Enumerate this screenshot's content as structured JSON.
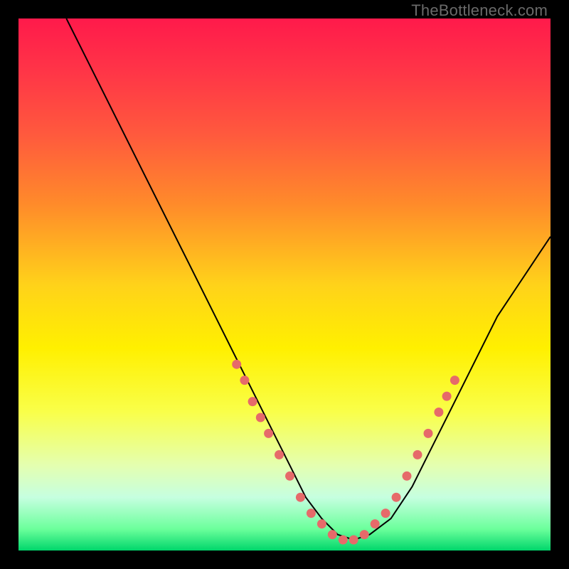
{
  "watermark": "TheBottleneck.com",
  "chart_data": {
    "type": "line",
    "title": "",
    "xlabel": "",
    "ylabel": "",
    "xlim": [
      0,
      100
    ],
    "ylim": [
      0,
      100
    ],
    "gradient_stops": [
      {
        "offset": 0.0,
        "color": "#ff1a4b"
      },
      {
        "offset": 0.1,
        "color": "#ff3547"
      },
      {
        "offset": 0.22,
        "color": "#ff5a3d"
      },
      {
        "offset": 0.35,
        "color": "#ff8b2a"
      },
      {
        "offset": 0.5,
        "color": "#ffd21a"
      },
      {
        "offset": 0.62,
        "color": "#fff000"
      },
      {
        "offset": 0.74,
        "color": "#f9ff4a"
      },
      {
        "offset": 0.84,
        "color": "#e4ffb0"
      },
      {
        "offset": 0.9,
        "color": "#c6ffe0"
      },
      {
        "offset": 0.96,
        "color": "#6bff9b"
      },
      {
        "offset": 1.0,
        "color": "#00d66b"
      }
    ],
    "series": [
      {
        "name": "bottleneck-curve",
        "type": "line",
        "x": [
          9,
          12,
          16,
          20,
          24,
          28,
          32,
          36,
          40,
          44,
          48,
          51,
          54,
          57,
          60,
          63,
          66,
          70,
          74,
          78,
          82,
          86,
          90,
          94,
          98,
          100
        ],
        "y": [
          100,
          94,
          86,
          78,
          70,
          62,
          54,
          46,
          38,
          30,
          22,
          16,
          10,
          6,
          3,
          2,
          3,
          6,
          12,
          20,
          28,
          36,
          44,
          50,
          56,
          59
        ]
      },
      {
        "name": "highlight-dots-left",
        "type": "scatter",
        "x": [
          41,
          42.5,
          44,
          45.5,
          47,
          49,
          51,
          53,
          55,
          57
        ],
        "y": [
          35,
          32,
          28,
          25,
          22,
          18,
          14,
          10,
          7,
          5
        ]
      },
      {
        "name": "highlight-dots-bottom",
        "type": "scatter",
        "x": [
          59,
          61,
          63,
          65,
          67,
          69
        ],
        "y": [
          3,
          2,
          2,
          3,
          5,
          7
        ]
      },
      {
        "name": "highlight-dots-right",
        "type": "scatter",
        "x": [
          71,
          73,
          75,
          77,
          79,
          80.5,
          82
        ],
        "y": [
          10,
          14,
          18,
          22,
          26,
          29,
          32
        ]
      }
    ],
    "colors": {
      "curve": "#000000",
      "dots": "#e66a6a"
    }
  }
}
